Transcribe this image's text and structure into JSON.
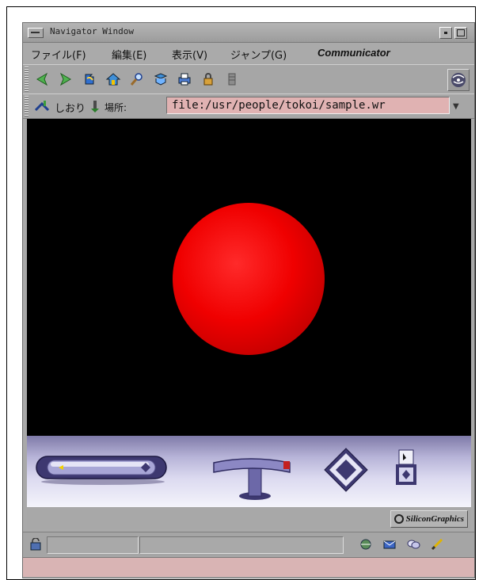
{
  "window": {
    "title": "Navigator Window"
  },
  "menubar": {
    "items": [
      "ファイル(F)",
      "編集(E)",
      "表示(V)",
      "ジャンプ(G)",
      "Communicator"
    ]
  },
  "toolbar": {
    "buttons": [
      "back-icon",
      "forward-icon",
      "reload-icon",
      "home-icon",
      "search-icon",
      "guide-icon",
      "print-icon",
      "security-icon",
      "stop-icon"
    ]
  },
  "location_bar": {
    "bookmarks_label": "しおり",
    "location_label": "場所:",
    "url": "file:/usr/people/tokoi/sample.wr"
  },
  "scene": {
    "object": "red sphere",
    "background_color": "#000000",
    "sphere_color": "#ff0000"
  },
  "vrml_controls": [
    "zoom-dolly-control",
    "pan-tilt-control",
    "rotate-diamond-control",
    "viewpoint-control"
  ],
  "branding": {
    "logo_text": "SiliconGraphics"
  },
  "statusbar": {
    "icons": [
      "component-bar-navigator-icon",
      "mail-icon",
      "discussion-icon",
      "composer-icon"
    ]
  }
}
